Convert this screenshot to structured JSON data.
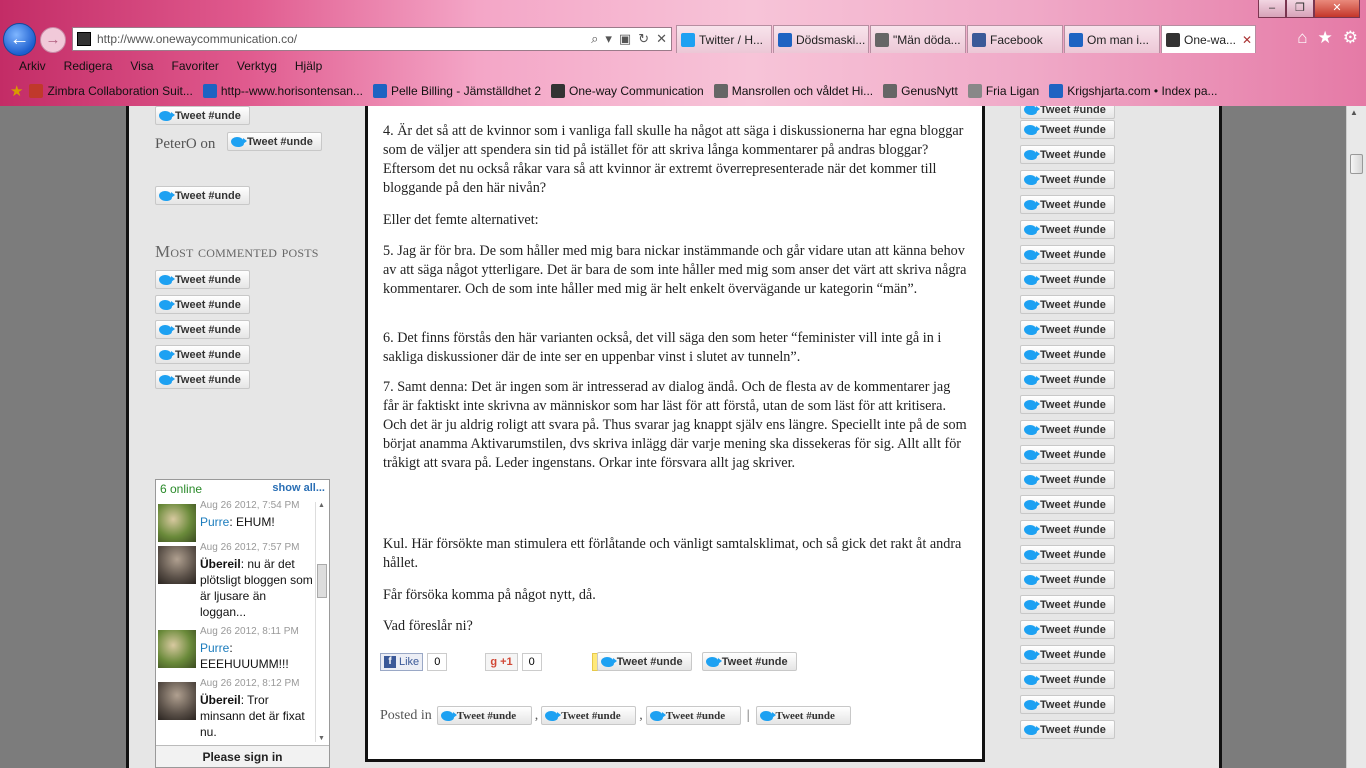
{
  "browser": {
    "address": "http://www.onewaycommunication.co/",
    "tabs": [
      {
        "label": "Twitter / H...",
        "color": "#1da1f2",
        "active": false
      },
      {
        "label": "Dödsmaski...",
        "color": "#1e63c2",
        "active": false
      },
      {
        "label": "\"Män döda...",
        "color": "#666666",
        "active": false
      },
      {
        "label": "Facebook",
        "color": "#3b5998",
        "active": false
      },
      {
        "label": "Om man i...",
        "color": "#1e63c2",
        "active": false
      },
      {
        "label": "One-wa...",
        "color": "#333333",
        "active": true
      }
    ],
    "menu": [
      "Arkiv",
      "Redigera",
      "Visa",
      "Favoriter",
      "Verktyg",
      "Hjälp"
    ],
    "favorites": [
      {
        "label": "Zimbra Collaboration Suit...",
        "color": "#c0392b"
      },
      {
        "label": "http--www.horisontensan...",
        "color": "#1e63c2"
      },
      {
        "label": "Pelle Billing - Jämställdhet 2",
        "color": "#1e63c2"
      },
      {
        "label": "One-way Communication",
        "color": "#333333"
      },
      {
        "label": "Mansrollen och våldet  Hi...",
        "color": "#666666"
      },
      {
        "label": "GenusNytt",
        "color": "#666666"
      },
      {
        "label": "Fria Ligan",
        "color": "#888888"
      },
      {
        "label": "Krigshjarta.com • Index pa...",
        "color": "#1e63c2"
      }
    ]
  },
  "tweet_label": "Tweet #unde",
  "left": {
    "peter": "PeterO on",
    "most_commented": "Most commented posts"
  },
  "chat": {
    "online": "6 online",
    "show_all": "show all...",
    "messages": [
      {
        "time": "Aug 26 2012, 7:54 PM",
        "user": "Purre",
        "text": "EHUM!",
        "style": "c"
      },
      {
        "time": "Aug 26 2012, 7:57 PM",
        "user": "Übereil",
        "text": "nu är det plötsligt bloggen som är ljusare än loggan...",
        "style": "b"
      },
      {
        "time": "Aug 26 2012, 8:11 PM",
        "user": "Purre",
        "text": "EEEHUUUMM!!!",
        "style": "c"
      },
      {
        "time": "Aug 26 2012, 8:12 PM",
        "user": "Übereil",
        "text": "Tror minsann det är fixat nu.",
        "style": "b"
      }
    ],
    "sign_in": "Please sign in"
  },
  "post": {
    "paragraphs": [
      "4. Är det så att de kvinnor som i vanliga fall skulle ha något att säga i diskussionerna har egna bloggar som de väljer att spendera sin tid på istället för att skriva långa kommentarer på andras bloggar? Eftersom det nu också råkar vara så att kvinnor är extremt överrepresenterade när det kommer till bloggande på den här nivån?",
      "Eller det femte alternativet:",
      "5. Jag är för bra. De som håller med mig bara nickar instämmande och går vidare utan att känna behov av att säga något ytterligare. Det är bara de som inte håller med mig som anser det värt att skriva några kommentarer. Och de som inte håller med mig är helt enkelt övervägande ur kategorin “män”.",
      "6. Det finns förstås den här varianten också, det vill säga den som heter “feminister vill inte gå in i sakliga diskussioner där de inte ser en uppenbar vinst i slutet av tunneln”.",
      "7. Samt denna: Det är ingen som är intresserad av dialog ändå. Och de flesta av de kommentarer jag får är faktiskt inte skrivna av människor som har läst för att förstå, utan de som läst för att kritisera. Och det är ju aldrig roligt att svara på. Thus svarar jag knappt själv ens längre. Speciellt inte på de som börjat anamma Aktivarumstilen, dvs skriva inlägg där varje mening ska dissekeras för sig. Allt allt för tråkigt att svara på. Leder ingenstans. Orkar inte försvara allt jag skriver.",
      "Kul. Här försökte man stimulera ett förlåtande och vänligt samtalsklimat, och så gick det rakt åt andra hållet.",
      "Får försöka komma på något nytt, då.",
      "Vad föreslår ni?"
    ],
    "like_label": "Like",
    "like_count": "0",
    "plus_label": "+1",
    "plus_count": "0",
    "posted_in": "Posted in",
    "sep_comma": ",",
    "sep_bar": "|"
  }
}
